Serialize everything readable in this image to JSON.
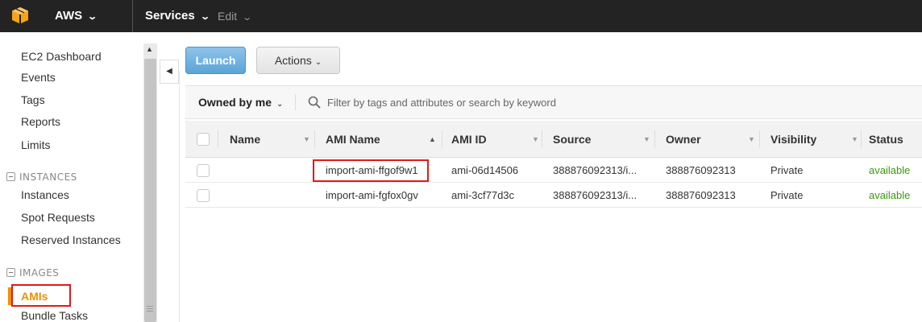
{
  "topbar": {
    "brand_label": "AWS",
    "services_label": "Services",
    "edit_label": "Edit",
    "logo_icon": "aws-cube-icon",
    "chevron_icon": "chevron-down-icon"
  },
  "sidebar": {
    "links": {
      "ec2_dashboard": "EC2 Dashboard",
      "events": "Events",
      "tags": "Tags",
      "reports": "Reports",
      "limits": "Limits"
    },
    "instances_section": {
      "heading": "INSTANCES",
      "items": {
        "instances": "Instances",
        "spot_requests": "Spot Requests",
        "reserved_instances": "Reserved Instances"
      }
    },
    "images_section": {
      "heading": "IMAGES",
      "items": {
        "amis": "AMIs",
        "bundle_tasks": "Bundle Tasks"
      }
    },
    "active_item": "AMIs",
    "active_color": "#f18f01"
  },
  "toolbar": {
    "launch_label": "Launch",
    "actions_label": "Actions"
  },
  "filter": {
    "owner_label": "Owned by me",
    "search_placeholder": "Filter by tags and attributes or search by keyword"
  },
  "table": {
    "columns": [
      "Name",
      "AMI Name",
      "AMI ID",
      "Source",
      "Owner",
      "Visibility",
      "Status"
    ],
    "rows": [
      {
        "name": "",
        "ami_name": "import-ami-ffgof9w1",
        "ami_id": "ami-06d14506",
        "source": "388876092313/i...",
        "owner": "388876092313",
        "visibility": "Private",
        "status": "available"
      },
      {
        "name": "",
        "ami_name": "import-ami-fgfox0gv",
        "ami_id": "ami-3cf77d3c",
        "source": "388876092313/i...",
        "owner": "388876092313",
        "visibility": "Private",
        "status": "available"
      }
    ],
    "status_color": "#3a9a0e"
  },
  "colors": {
    "topbar_bg": "#232323",
    "launch_button": "#5ba4d8",
    "highlight_border": "#e01919"
  }
}
